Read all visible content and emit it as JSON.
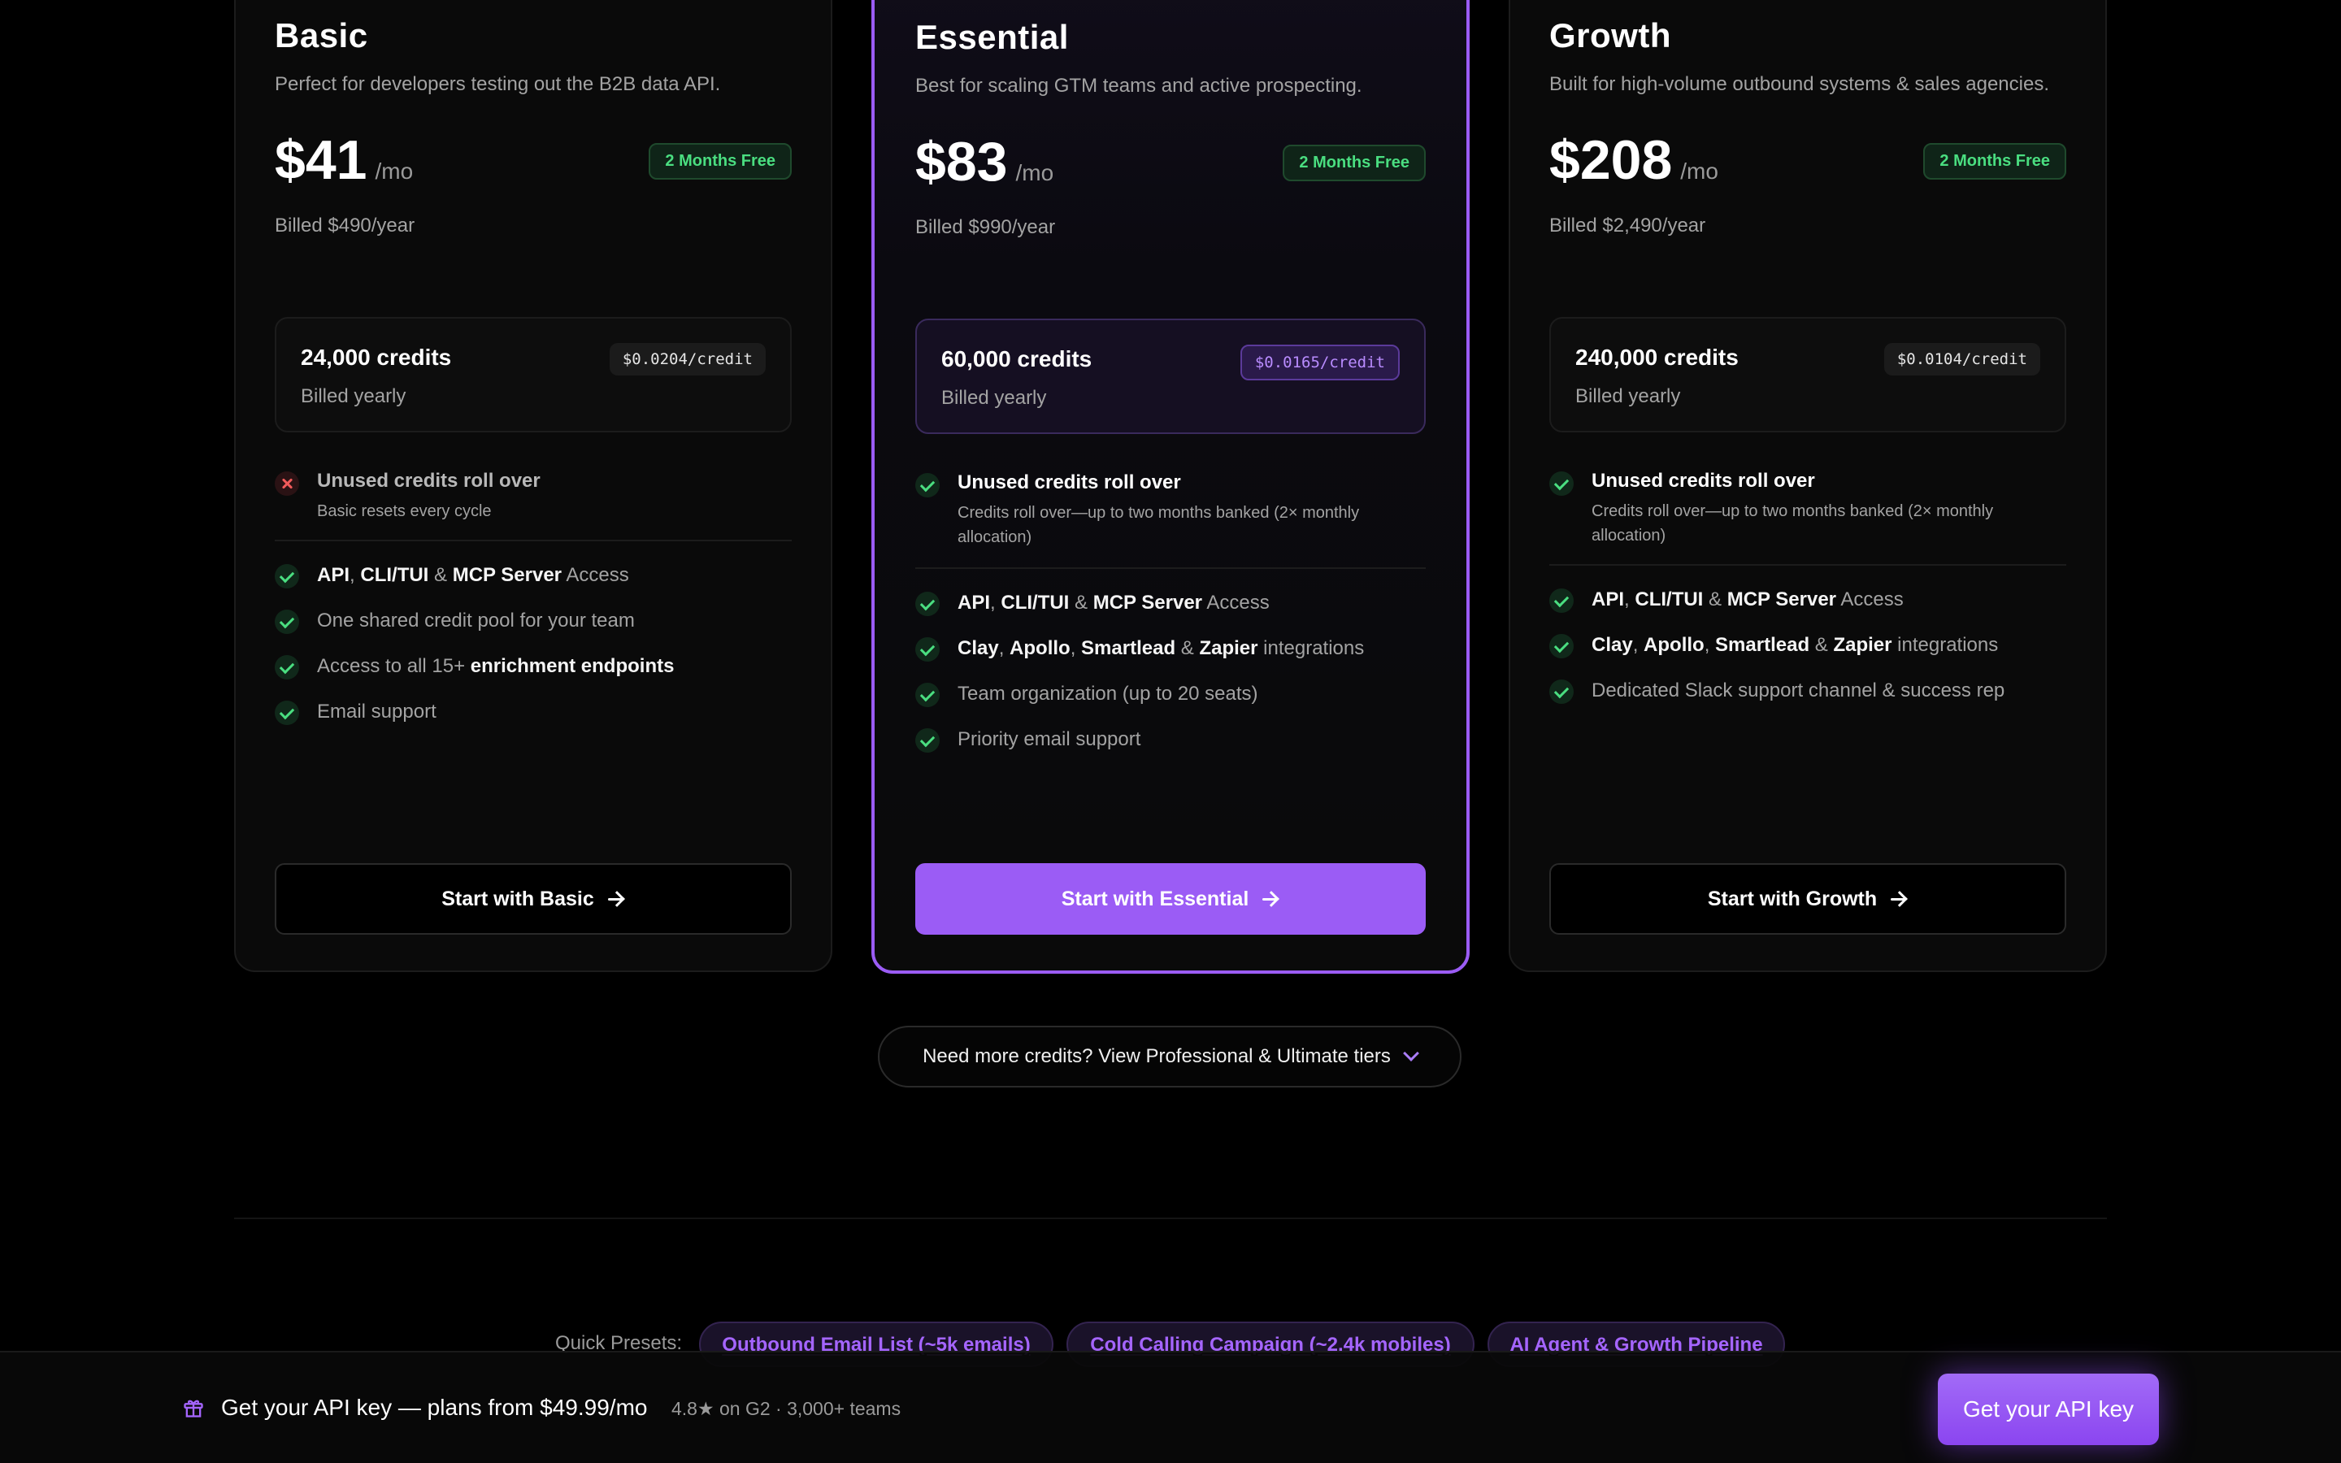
{
  "plans": [
    {
      "name": "Basic",
      "description": "Perfect for developers testing out the B2B data API.",
      "price": "$41",
      "period": "/mo",
      "badge": "2 Months Free",
      "billed": "Billed $490/year",
      "credits": "24,000 credits",
      "credits_sub": "Billed yearly",
      "per_credit": "$0.0204/credit",
      "rollover_title": "Unused credits roll over",
      "rollover_sub": "Basic resets every cycle",
      "rollover_included": false,
      "features": [
        {
          "b1": "API",
          "t1": ", ",
          "b2": "CLI/TUI",
          "t2": " & ",
          "b3": "MCP Server",
          "t3": " Access"
        },
        {
          "t0": "One shared credit pool for your team"
        },
        {
          "t0": "Access to all 15+ ",
          "b1": "enrichment endpoints"
        },
        {
          "t0": "Email support"
        }
      ],
      "cta": "Start with Basic"
    },
    {
      "name": "Essential",
      "description": "Best for scaling GTM teams and active prospecting.",
      "price": "$83",
      "period": "/mo",
      "badge": "2 Months Free",
      "billed": "Billed $990/year",
      "credits": "60,000 credits",
      "credits_sub": "Billed yearly",
      "per_credit": "$0.0165/credit",
      "rollover_title": "Unused credits roll over",
      "rollover_sub_1": "Credits roll over—up to two months banked (2× monthly",
      "rollover_sub_2": "allocation)",
      "rollover_included": true,
      "features": [
        {
          "b1": "API",
          "t1": ", ",
          "b2": "CLI/TUI",
          "t2": " & ",
          "b3": "MCP Server",
          "t3": " Access"
        },
        {
          "b1": "Clay",
          "t1": ", ",
          "b2": "Apollo",
          "t2": ", ",
          "b3": "Smartlead",
          "t3": " & ",
          "b4": "Zapier",
          "t4": " integrations"
        },
        {
          "t0": "Team organization (up to 20 seats)"
        },
        {
          "t0": "Priority email support"
        }
      ],
      "cta": "Start with Essential"
    },
    {
      "name": "Growth",
      "description": "Built for high-volume outbound systems & sales agencies.",
      "price": "$208",
      "period": "/mo",
      "badge": "2 Months Free",
      "billed": "Billed $2,490/year",
      "credits": "240,000 credits",
      "credits_sub": "Billed yearly",
      "per_credit": "$0.0104/credit",
      "rollover_title": "Unused credits roll over",
      "rollover_sub_1": "Credits roll over—up to two months banked (2× monthly",
      "rollover_sub_2": "allocation)",
      "rollover_included": true,
      "features": [
        {
          "b1": "API",
          "t1": ", ",
          "b2": "CLI/TUI",
          "t2": " & ",
          "b3": "MCP Server",
          "t3": " Access"
        },
        {
          "b1": "Clay",
          "t1": ", ",
          "b2": "Apollo",
          "t2": ", ",
          "b3": "Smartlead",
          "t3": " & ",
          "b4": "Zapier",
          "t4": " integrations"
        },
        {
          "t0": "Dedicated Slack support channel & success rep"
        }
      ],
      "cta": "Start with Growth"
    }
  ],
  "more_credits": "Need more credits? View Professional & Ultimate tiers",
  "presets": {
    "label": "Quick Presets:",
    "items": [
      "Outbound Email List (~5k emails)",
      "Cold Calling Campaign (~2.4k mobiles)",
      "AI Agent & Growth Pipeline"
    ]
  },
  "bottom_bar": {
    "text": "Get your API key — plans from $49.99/mo",
    "rating": "4.8★ on G2 · 3,000+ teams",
    "button": "Get your API key"
  },
  "colors": {
    "accent": "#9b5cf5",
    "success": "#4ade80",
    "danger": "#f05a5a",
    "background": "#000000"
  },
  "icons": [
    "check-icon",
    "cross-icon",
    "arrow-right-icon",
    "chevron-down-icon",
    "gift-icon"
  ]
}
